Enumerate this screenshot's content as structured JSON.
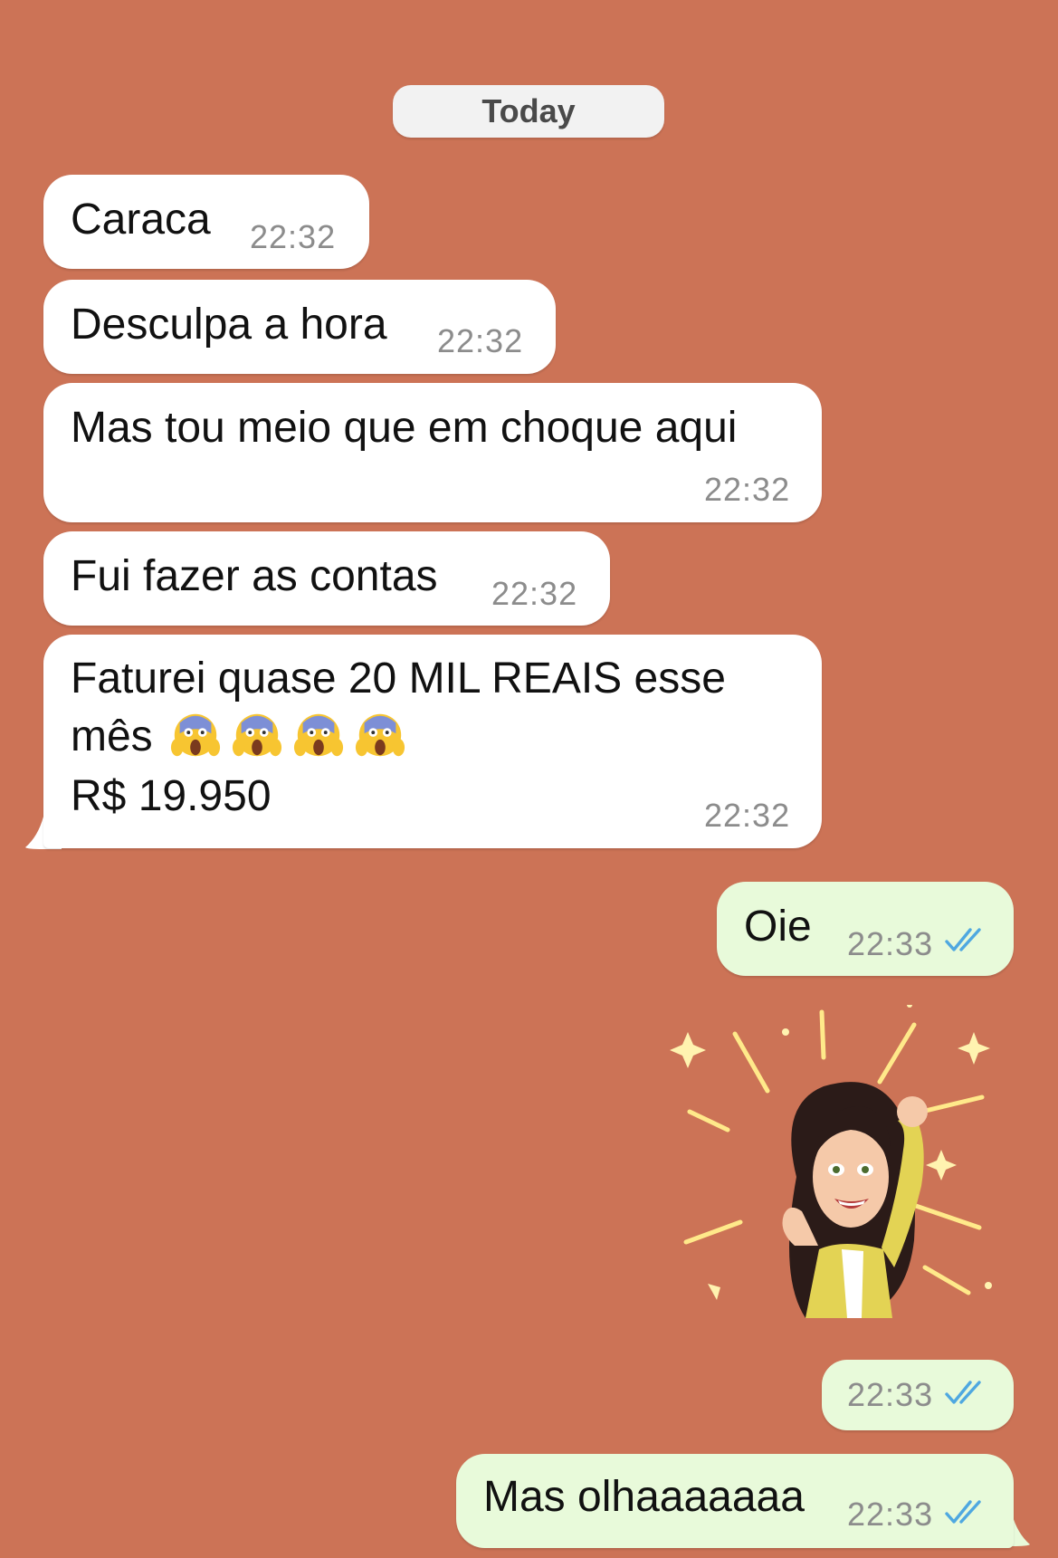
{
  "date_separator": "Today",
  "incoming": [
    {
      "text": "Caraca",
      "time": "22:32"
    },
    {
      "text": "Desculpa a hora",
      "time": "22:32"
    },
    {
      "text": "Mas tou meio que em choque aqui",
      "time": "22:32"
    },
    {
      "text": "Fui fazer as contas",
      "time": "22:32"
    },
    {
      "line1": "Faturei quase 20 MIL REAIS esse",
      "line2": "mês",
      "line3": "R$ 19.950",
      "emoji": "screaming-face-emoji",
      "emoji_count": 4,
      "time": "22:32"
    }
  ],
  "outgoing": [
    {
      "text": "Oie",
      "time": "22:33",
      "status": "read"
    },
    {
      "type": "sticker",
      "sticker": "celebrating-woman-avatar",
      "time": "22:33",
      "status": "read"
    },
    {
      "text": "Mas olhaaaaaaa",
      "time": "22:33",
      "status": "read"
    }
  ],
  "colors": {
    "wallpaper": "#CC7356",
    "incoming_bubble": "#FFFFFF",
    "outgoing_bubble": "#E8FADA",
    "read_ticks": "#4FA8E0",
    "timestamp": "#8C8C8C"
  }
}
